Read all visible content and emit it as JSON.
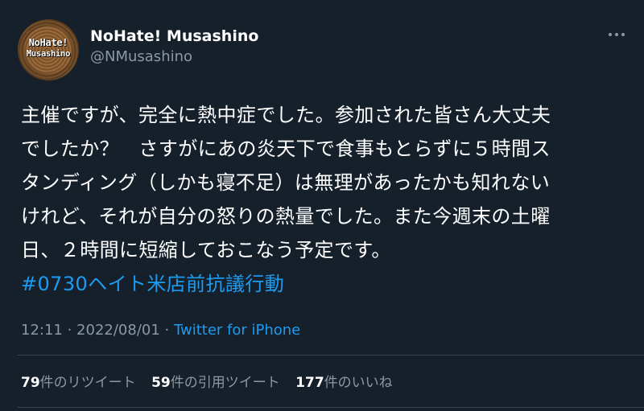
{
  "author": {
    "avatar_text_line1": "NoHate!",
    "avatar_text_line2": "Musashino",
    "display_name": "NoHate! Musashino",
    "handle": "@NMusashino"
  },
  "more_icon": "ellipsis-icon",
  "tweet": {
    "lines": [
      "主催ですが、完全に熱中症でした。参加された皆さん大丈夫",
      "でしたか？　さすがにあの炎天下で食事もとらずに５時間ス",
      "タンディング（しかも寝不足）は無理があったかも知れない",
      "けれど、それが自分の怒りの熱量でした。また今週末の土曜",
      "日、２時間に短縮しておこなう予定です。"
    ],
    "hashtag": "#0730ヘイト米店前抗議行動"
  },
  "meta": {
    "time": "12:11",
    "sep1": " · ",
    "date": "2022/08/01",
    "sep2": " · ",
    "source": "Twitter for iPhone"
  },
  "stats": {
    "retweets_count": "79",
    "retweets_label": "件のリツイート",
    "quotes_count": "59",
    "quotes_label": "件の引用ツイート",
    "likes_count": "177",
    "likes_label": "件のいいね"
  },
  "colors": {
    "background": "#15202b",
    "link": "#1d9bf0",
    "secondary_text": "#8b98a5",
    "divider": "#38444d"
  }
}
